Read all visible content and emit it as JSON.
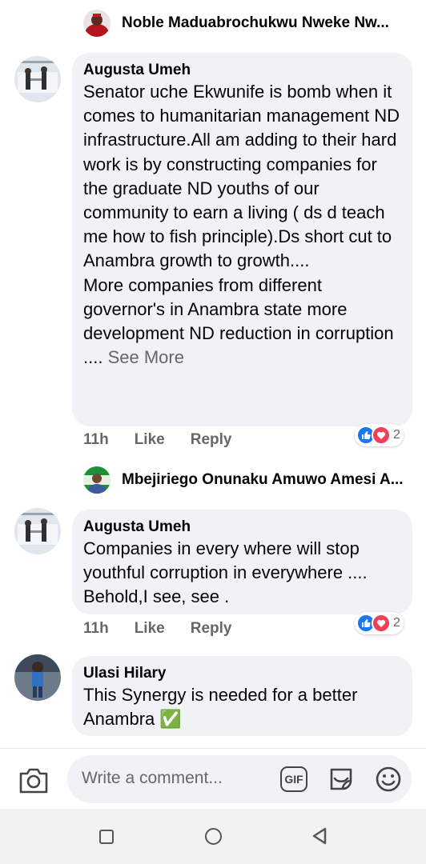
{
  "replies_preview": [
    {
      "name": "Noble Maduabrochukwu Nweke Nw..."
    },
    {
      "name": "Mbejiriego Onunaku Amuwo Amesi A..."
    }
  ],
  "comments": [
    {
      "author": "Augusta Umeh",
      "text": "Senator uche Ekwunife is bomb when it comes to humanitarian management ND infrastructure.All am adding to their hard work is by constructing companies for the graduate ND youths of our community to earn a living ( ds d teach me how to fish principle).Ds short cut to Anambra growth to growth....\nMore companies from different governor's in Anambra state more development ND reduction in corruption ....",
      "see_more": "See More",
      "time": "11h",
      "like_label": "Like",
      "reply_label": "Reply",
      "reaction_count": "2"
    },
    {
      "author": "Augusta Umeh",
      "text": "Companies in every where will stop youthful corruption in everywhere ....\nBehold,I see, see .",
      "time": "11h",
      "like_label": "Like",
      "reply_label": "Reply",
      "reaction_count": "2"
    },
    {
      "author": "Ulasi Hilary",
      "text": "This Synergy is needed for a better Anambra",
      "emoji": "✅"
    }
  ],
  "composer": {
    "placeholder": "Write a comment...",
    "gif_label": "GIF"
  },
  "icons": {
    "camera": "camera-icon",
    "gif": "gif-icon",
    "sticker": "sticker-icon",
    "emoji": "emoji-icon",
    "like_reaction": "like-reaction-icon",
    "love_reaction": "love-reaction-icon"
  },
  "colors": {
    "bubble": "#f0f2f5",
    "secondary_text": "#65676b",
    "like_blue": "#1877f2",
    "love_red": "#f33e58"
  }
}
